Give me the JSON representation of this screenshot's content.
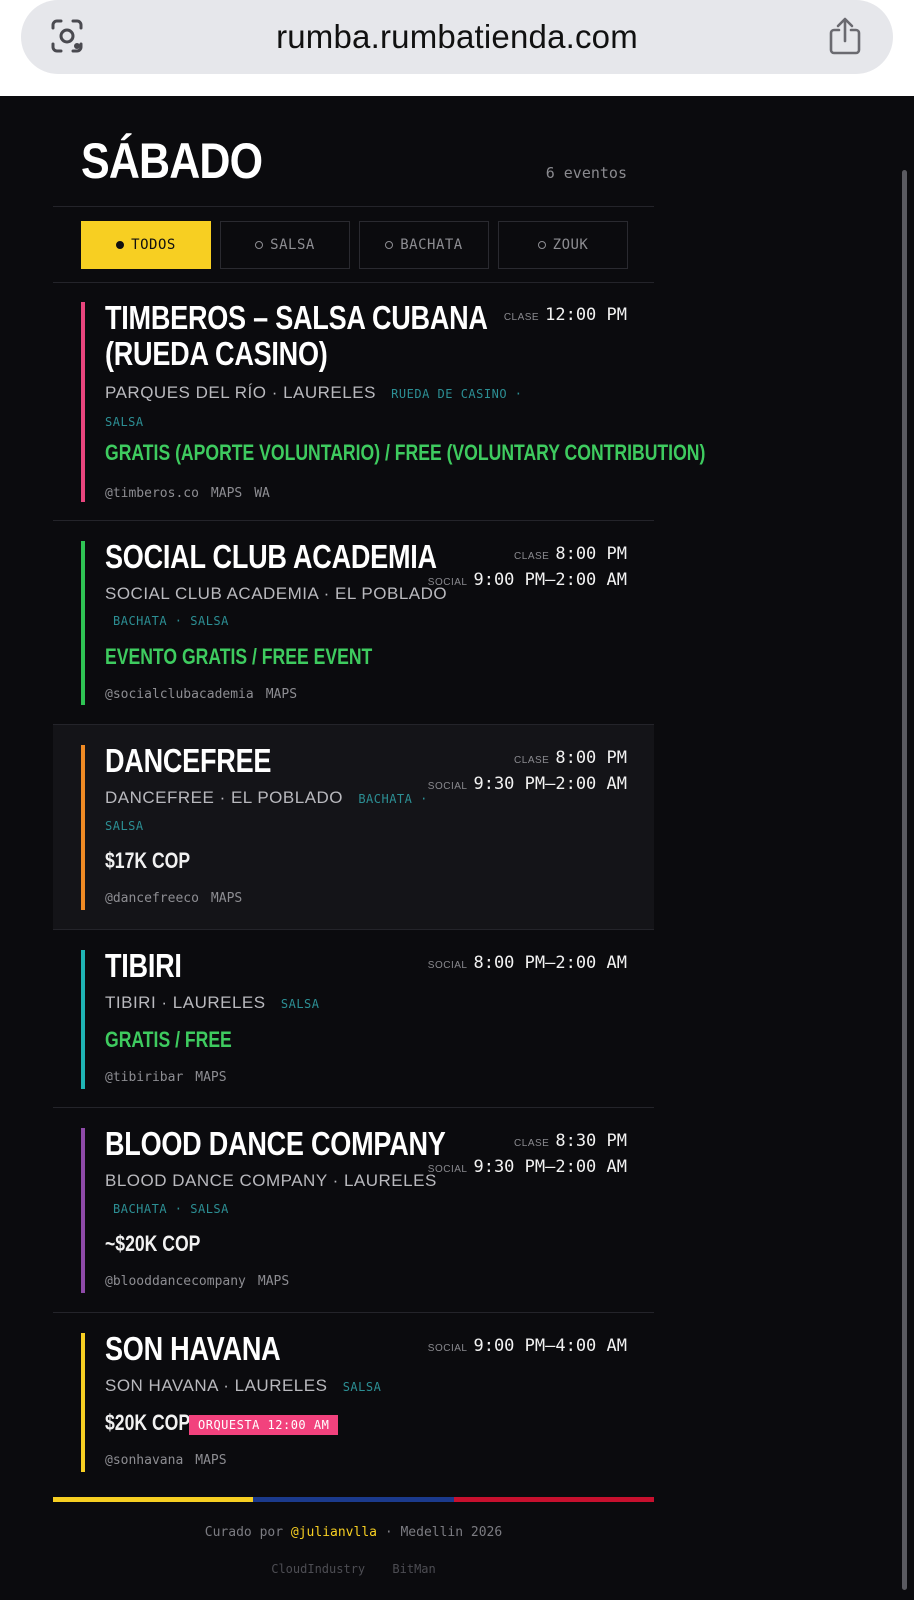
{
  "browser": {
    "url": "rumba.rumbatienda.com"
  },
  "header": {
    "day": "SÁBADO",
    "count": "6 eventos"
  },
  "filters": [
    {
      "label": "TODOS",
      "active": true
    },
    {
      "label": "SALSA",
      "active": false
    },
    {
      "label": "BACHATA",
      "active": false
    },
    {
      "label": "ZOUK",
      "active": false
    }
  ],
  "events": [
    {
      "title_lines": [
        "TIMBEROS – SALSA CUBANA",
        "(RUEDA CASINO)"
      ],
      "venue": "PARQUES DEL RÍO · LAURELES",
      "tags_a": "RUEDA DE CASINO ·",
      "tags_b": "SALSA",
      "price": "GRATIS (APORTE VOLUNTARIO) / FREE (VOLUNTARY CONTRIBUTION)",
      "links": [
        "@timberos.co",
        "MAPS",
        "WA"
      ],
      "times": [
        {
          "kind": "CLASE",
          "value": "12:00 PM"
        }
      ],
      "color": "#e8457d"
    },
    {
      "title_lines": [
        "SOCIAL CLUB ACADEMIA"
      ],
      "venue": "SOCIAL CLUB ACADEMIA · EL POBLADO",
      "tags_b": "BACHATA · SALSA",
      "price": "EVENTO GRATIS / FREE EVENT",
      "links": [
        "@socialclubacademia",
        "MAPS"
      ],
      "times": [
        {
          "kind": "CLASE",
          "value": "8:00 PM"
        },
        {
          "kind": "SOCIAL",
          "value": "9:00 PM–2:00 AM"
        }
      ],
      "color": "#2fc454"
    },
    {
      "title_lines": [
        "DANCEFREE"
      ],
      "venue": "DANCEFREE · EL POBLADO",
      "tags_a": "BACHATA ·",
      "tags_b": "SALSA",
      "price": "$17K COP",
      "links": [
        "@dancefreeco",
        "MAPS"
      ],
      "times": [
        {
          "kind": "CLASE",
          "value": "8:00 PM"
        },
        {
          "kind": "SOCIAL",
          "value": "9:30 PM–2:00 AM"
        }
      ],
      "color": "#f08a24"
    },
    {
      "title_lines": [
        "TIBIRI"
      ],
      "venue": "TIBIRI · LAURELES",
      "tags_a": "SALSA",
      "price": "GRATIS / FREE",
      "links": [
        "@tibiribar",
        "MAPS"
      ],
      "times": [
        {
          "kind": "SOCIAL",
          "value": "8:00 PM–2:00 AM"
        }
      ],
      "color": "#1fb5b5"
    },
    {
      "title_lines": [
        "BLOOD DANCE COMPANY"
      ],
      "venue": "BLOOD DANCE COMPANY · LAURELES",
      "tags_b": "BACHATA · SALSA",
      "price": "~$20K COP",
      "links": [
        "@blooddancecompany",
        "MAPS"
      ],
      "times": [
        {
          "kind": "CLASE",
          "value": "8:30 PM"
        },
        {
          "kind": "SOCIAL",
          "value": "9:30 PM–2:00 AM"
        }
      ],
      "color": "#8e4aa8"
    },
    {
      "title_lines": [
        "SON HAVANA"
      ],
      "venue": "SON HAVANA · LAURELES",
      "tags_a": "SALSA",
      "price": "$20K COP",
      "badge": "ORQUESTA 12:00 AM",
      "links": [
        "@sonhavana",
        "MAPS"
      ],
      "times": [
        {
          "kind": "SOCIAL",
          "value": "9:00 PM–4:00 AM"
        }
      ],
      "color": "#f7cf22"
    }
  ],
  "flag_colors": [
    "#f7cf22",
    "#1b3a8c",
    "#c8102e"
  ],
  "footer": {
    "curated_prefix": "Curado por",
    "handle": "@julianvlla",
    "suffix": "· Medellin 2026",
    "credits": [
      "CloudIndustry",
      "BitMan"
    ]
  }
}
